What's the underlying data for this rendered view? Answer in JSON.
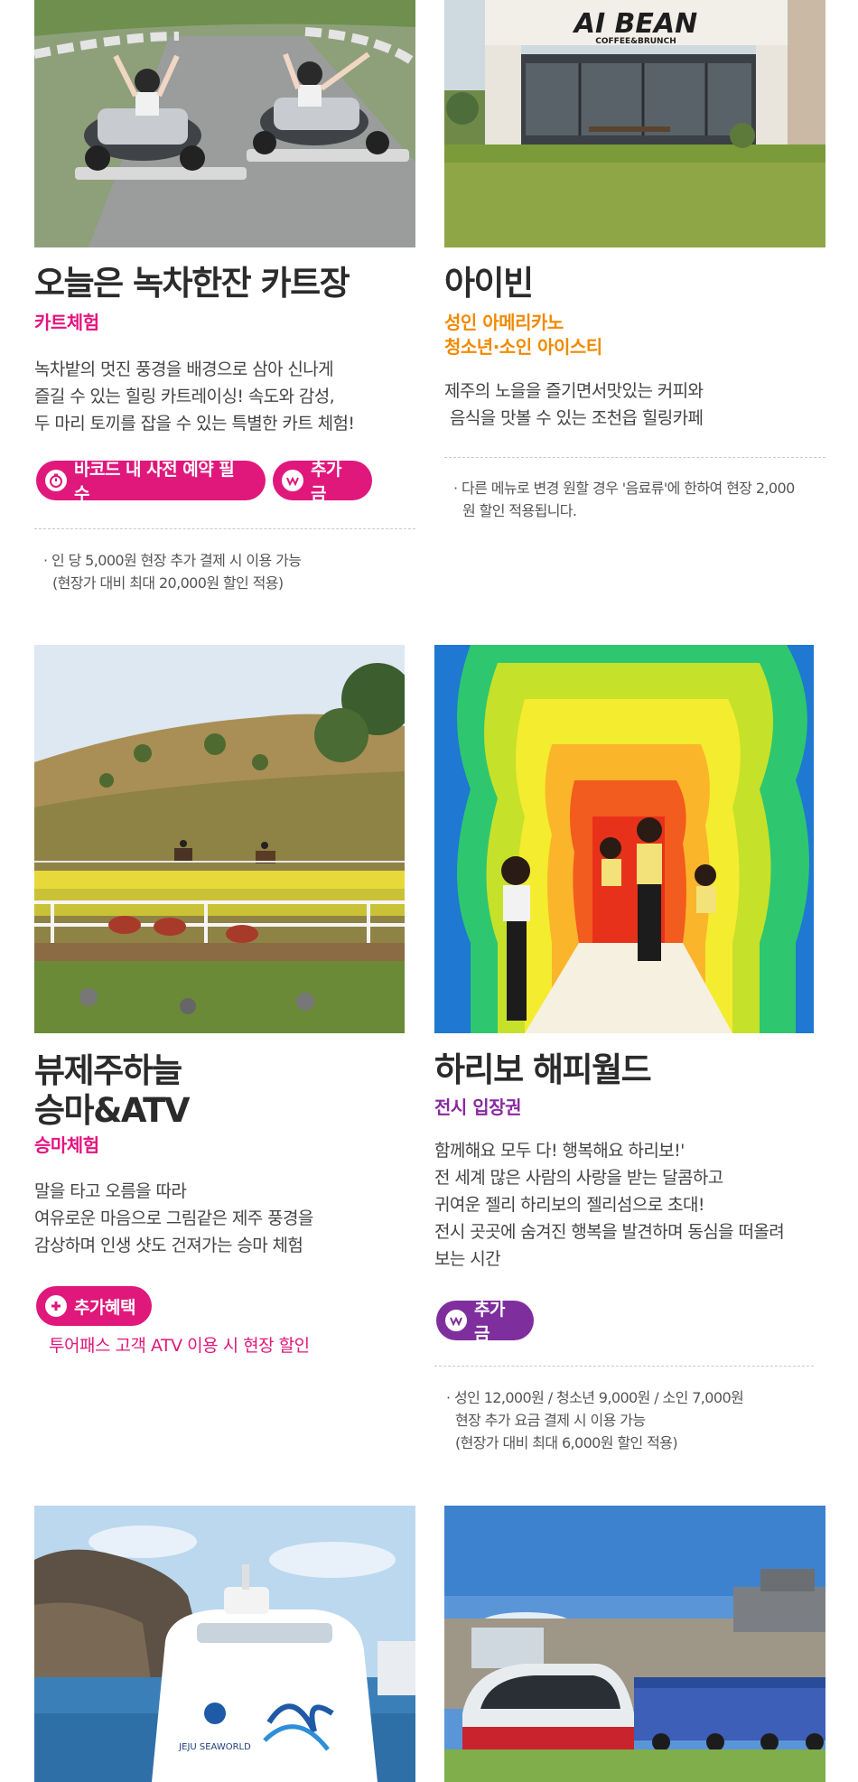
{
  "cards": {
    "kart": {
      "title": "오늘은 녹차한잔 카트장",
      "subtitle": "카트체험",
      "desc": [
        "녹차밭의 멋진 풍경을 배경으로 삼아 신나게",
        "즐길 수 있는 힐링 카트레이싱! 속도와 감성,",
        "두 마리 토끼를 잡을 수 있는 특별한 카트 체험!"
      ],
      "badge1": "바코드 내 사전 예약 필수",
      "badge2": "추가금",
      "note": [
        "· 인 당 5,000원 현장 추가 결제 시 이용 가능",
        "(현장가 대비 최대 20,000원 할인 적용)"
      ]
    },
    "aibean": {
      "title": "아이빈",
      "subtitle": [
        "성인 아메리카노",
        "청소년·소인 아이스티"
      ],
      "sign": "AI BEAN",
      "sign_sub": "COFFEE&BRUNCH",
      "desc": [
        "제주의 노을을 즐기면서맛있는 커피와",
        "음식을 맛볼 수 있는 조천읍 힐링카페"
      ],
      "note": [
        "· 다른 메뉴로 변경 원할 경우 '음료류'에 한하여 현장 2,000",
        "원 할인 적용됩니다."
      ]
    },
    "horse": {
      "title": [
        "뷰제주하늘",
        "승마&ATV"
      ],
      "subtitle": "승마체험",
      "desc": [
        "말을 타고 오름을 따라",
        "여유로운 마음으로 그림같은 제주 풍경을",
        "감상하며 인생 샷도 건져가는 승마 체험"
      ],
      "badge": "추가혜택",
      "benefit": "투어패스 고객 ATV 이용 시 현장 할인"
    },
    "haribo": {
      "title": "하리보 해피월드",
      "subtitle": "전시 입장권",
      "desc": [
        "함께해요 모두 다! 행복해요 하리보!'",
        "전 세계 많은 사람의 사랑을 받는 달콤하고",
        "귀여운 젤리 하리보의 젤리섬으로 초대!",
        "전시 곳곳에 숨겨진 행복을 발견하며 동심을 떠올려",
        "보는 시간"
      ],
      "badge": "추가금",
      "note": [
        "· 성인 12,000원 / 청소년 9,000원 / 소인 7,000원",
        "현장 추가 요금 결제 시 이용 가능",
        "(현장가 대비 최대 6,000원 할인 적용)"
      ]
    },
    "seaworld": {
      "logo": "JEJU SEAWORLD"
    }
  },
  "colors": {
    "pink": "#e0187c",
    "orange": "#f08a00",
    "purple": "#7f2f9d"
  }
}
